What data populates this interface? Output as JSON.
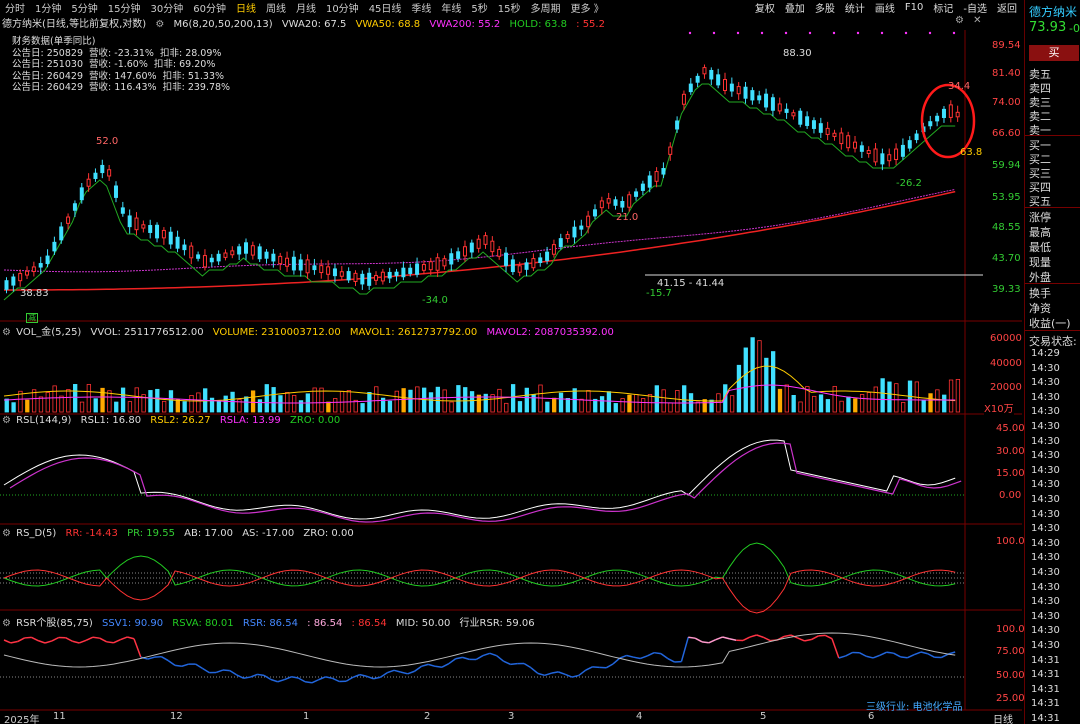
{
  "periods": [
    "分时",
    "1分钟",
    "5分钟",
    "15分钟",
    "30分钟",
    "60分钟",
    "日线",
    "周线",
    "月线",
    "10分钟",
    "45日线",
    "季线",
    "年线",
    "5秒",
    "15秒",
    "多周期",
    "更多"
  ],
  "active_period": "日线",
  "toolbar_right": [
    "复权",
    "叠加",
    "多股",
    "统计",
    "画线",
    "F10",
    "标记",
    "-自选",
    "返回"
  ],
  "main_legend": {
    "stock": "德方纳米(日线,等比前复权,对数)",
    "ma": "M6(8,20,50,200,13)",
    "vwa20": "VWA20: 67.5",
    "vwa50": "VWA50: 68.8",
    "vwa200": "VWA200: 55.2",
    "hold": "HOLD: 63.8",
    "hold2": ": 55.2"
  },
  "fin_title": "财务数据(单季同比)",
  "fin_rows": [
    {
      "date": "公告日: 250829",
      "rev": "营收: -23.31%",
      "np": "扣非: 28.09%"
    },
    {
      "date": "公告日: 251030",
      "rev": "营收: -1.60%",
      "np": "扣非: 69.20%"
    },
    {
      "date": "公告日: 260429",
      "rev": "营收: 147.60%",
      "np": "扣非: 51.33%"
    },
    {
      "date": "公告日: 260429",
      "rev": "营收: 116.43%",
      "np": "扣非: 239.78%"
    }
  ],
  "price_axis": [
    "89.54",
    "81.40",
    "74.00",
    "66.60",
    "59.94",
    "53.95",
    "48.55",
    "43.70",
    "39.33"
  ],
  "annotations": {
    "p52": "52.0",
    "p21": "21.0",
    "p8830": "88.30",
    "p344": "34.4",
    "p638": "63.8",
    "p3883": "38.83",
    "n340": "-34.0",
    "n157": "-15.7",
    "n262": "-26.2",
    "range": "41.15 - 41.44",
    "tag": "减"
  },
  "vol_legend": {
    "name": "VOL_金(5,25)",
    "vvol": "VVOL: 2511776512.00",
    "volume": "VOLUME: 2310003712.00",
    "mavol1": "MAVOL1: 2612737792.00",
    "mavol2": "MAVOL2: 2087035392.00"
  },
  "vol_axis": [
    "60000",
    "40000",
    "20000"
  ],
  "vol_unit": "X10万",
  "rsl_legend": {
    "name": "RSL(144,9)",
    "rsl1": "RSL1: 16.80",
    "rsl2": "RSL2: 26.27",
    "rsla": "RSLA: 13.99",
    "zro": "ZRO: 0.00"
  },
  "rsl_axis": [
    "45.00",
    "30.00",
    "15.00",
    "0.00"
  ],
  "rsd_legend": {
    "name": "RS_D(5)",
    "rr": "RR: -14.43",
    "pr": "PR: 19.55",
    "ab": "AB: 17.00",
    "as": "AS: -17.00",
    "zro": "ZRO: 0.00"
  },
  "rsd_axis": [
    "100.0"
  ],
  "rsr_legend": {
    "name": "RSR个股(85,75)",
    "ssv1": "SSV1: 90.90",
    "rsva": "RSVA: 80.01",
    "rsr": "RSR: 86.54",
    "v1": ": 86.54",
    "v2": ": 86.54",
    "mid": "MID: 50.00",
    "ind": "行业RSR: 59.06"
  },
  "rsr_axis": [
    "100.0",
    "75.00",
    "50.00",
    "25.00"
  ],
  "industry": "三级行业: 电池化学品",
  "date_axis": [
    "2025年",
    "11",
    "12",
    "1",
    "2",
    "3",
    "4",
    "5",
    "6"
  ],
  "date_axis_right": "日线",
  "side": {
    "name": "德方纳米",
    "price": "73.93",
    "chg": "-0",
    "buy_btn": "买",
    "sell": [
      "卖五",
      "卖四",
      "卖三",
      "卖二",
      "卖一"
    ],
    "buy": [
      "买一",
      "买二",
      "买三",
      "买四",
      "买五"
    ],
    "stats": [
      "涨停",
      "最高",
      "最低",
      "现量",
      "外盘"
    ],
    "stats2": [
      "换手",
      "净资",
      "收益(一)"
    ],
    "trade_status": "交易状态: 连",
    "times": [
      "14:29",
      "14:30",
      "14:30",
      "14:30",
      "14:30",
      "14:30",
      "14:30",
      "14:30",
      "14:30",
      "14:30",
      "14:30",
      "14:30",
      "14:30",
      "14:30",
      "14:30",
      "14:30",
      "14:30",
      "14:30",
      "14:30",
      "14:30",
      "14:30",
      "14:31",
      "14:31",
      "14:31",
      "14:31",
      "14:31"
    ]
  },
  "colors": {
    "up": "#ff3333",
    "down": "#40e0ff",
    "bg": "#000000",
    "yellow": "#ffcc00",
    "magenta": "#ff33ff",
    "green": "#22cc22",
    "orange": "#ff8844"
  }
}
